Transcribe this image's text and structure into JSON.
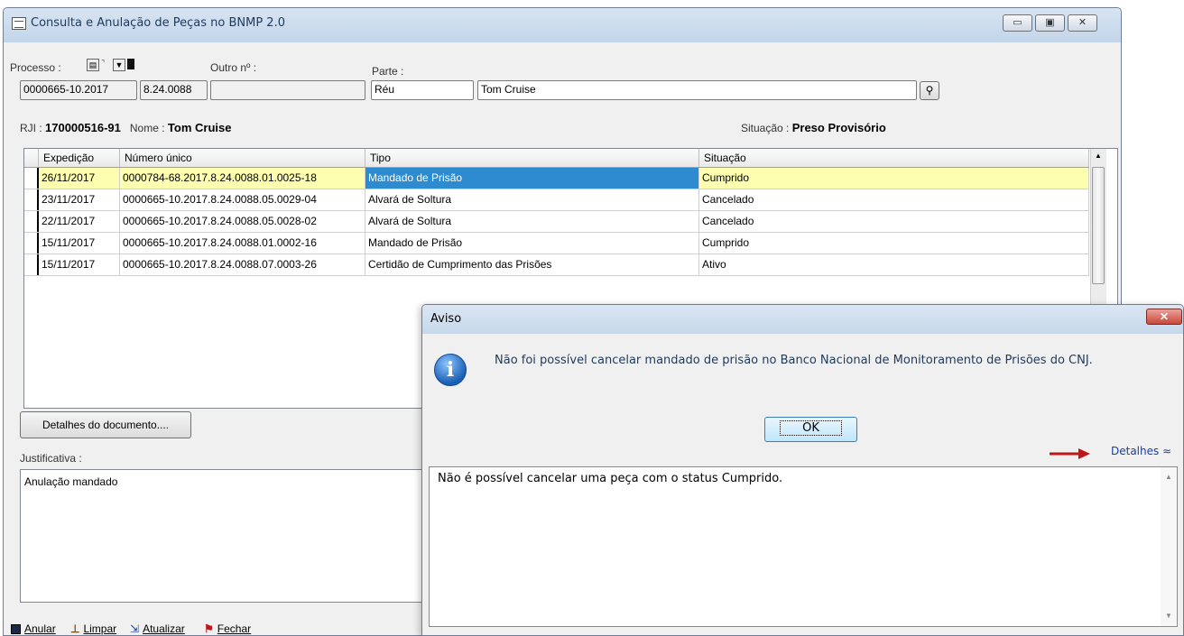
{
  "window": {
    "title": "Consulta e Anulação de Peças no BNMP 2.0",
    "min_glyph": "▭",
    "max_glyph": "▣",
    "close_glyph": "✕"
  },
  "form": {
    "processo_label": "Processo :",
    "processo_part1": "0000665-10.2017",
    "processo_part2": "8.24.0088",
    "outro_label": "Outro nº :",
    "outro_value": "",
    "parte_label": "Parte :",
    "parte_tipo": "Réu",
    "parte_nome": "Tom Cruise",
    "rji_label": "RJI :",
    "rji_value": "170000516-91",
    "nome_label": "Nome :",
    "nome_value": "Tom Cruise",
    "situacao_label": "Situação :",
    "situacao_value": "Preso Provisório"
  },
  "table": {
    "columns": [
      "Expedição",
      "Número único",
      "Tipo",
      "Situação"
    ],
    "rows": [
      [
        "26/11/2017",
        "0000784-68.2017.8.24.0088.01.0025-18",
        "Mandado de Prisão",
        "Cumprido"
      ],
      [
        "23/11/2017",
        "0000665-10.2017.8.24.0088.05.0029-04",
        "Alvará de Soltura",
        "Cancelado"
      ],
      [
        "22/11/2017",
        "0000665-10.2017.8.24.0088.05.0028-02",
        "Alvará de Soltura",
        "Cancelado"
      ],
      [
        "15/11/2017",
        "0000665-10.2017.8.24.0088.01.0002-16",
        "Mandado de Prisão",
        "Cumprido"
      ],
      [
        "15/11/2017",
        "0000665-10.2017.8.24.0088.07.0003-26",
        "Certidão de Cumprimento das Prisões",
        "Ativo"
      ]
    ]
  },
  "detalhes_button": "Detalhes do documento....",
  "justificativa_label": "Justificativa :",
  "justificativa_value": "Anulação mandado",
  "toolbar": {
    "anular": "Anular",
    "limpar": "Limpar",
    "atualizar": "Atualizar",
    "fechar": "Fechar"
  },
  "dialog": {
    "title": "Aviso",
    "close_glyph": "✕",
    "icon_glyph": "i",
    "message": "Não foi possível cancelar mandado de prisão no Banco Nacional de Monitoramento de Prisões do CNJ.",
    "ok_label": "OK",
    "details_link": "Detalhes ≈",
    "details_text": "Não é possível cancelar uma peça com o status Cumprido."
  },
  "colors": {
    "selected_row": "#fefeb0",
    "selected_cell": "#2e8bd0",
    "annotation_arrow": "#c0161a"
  }
}
